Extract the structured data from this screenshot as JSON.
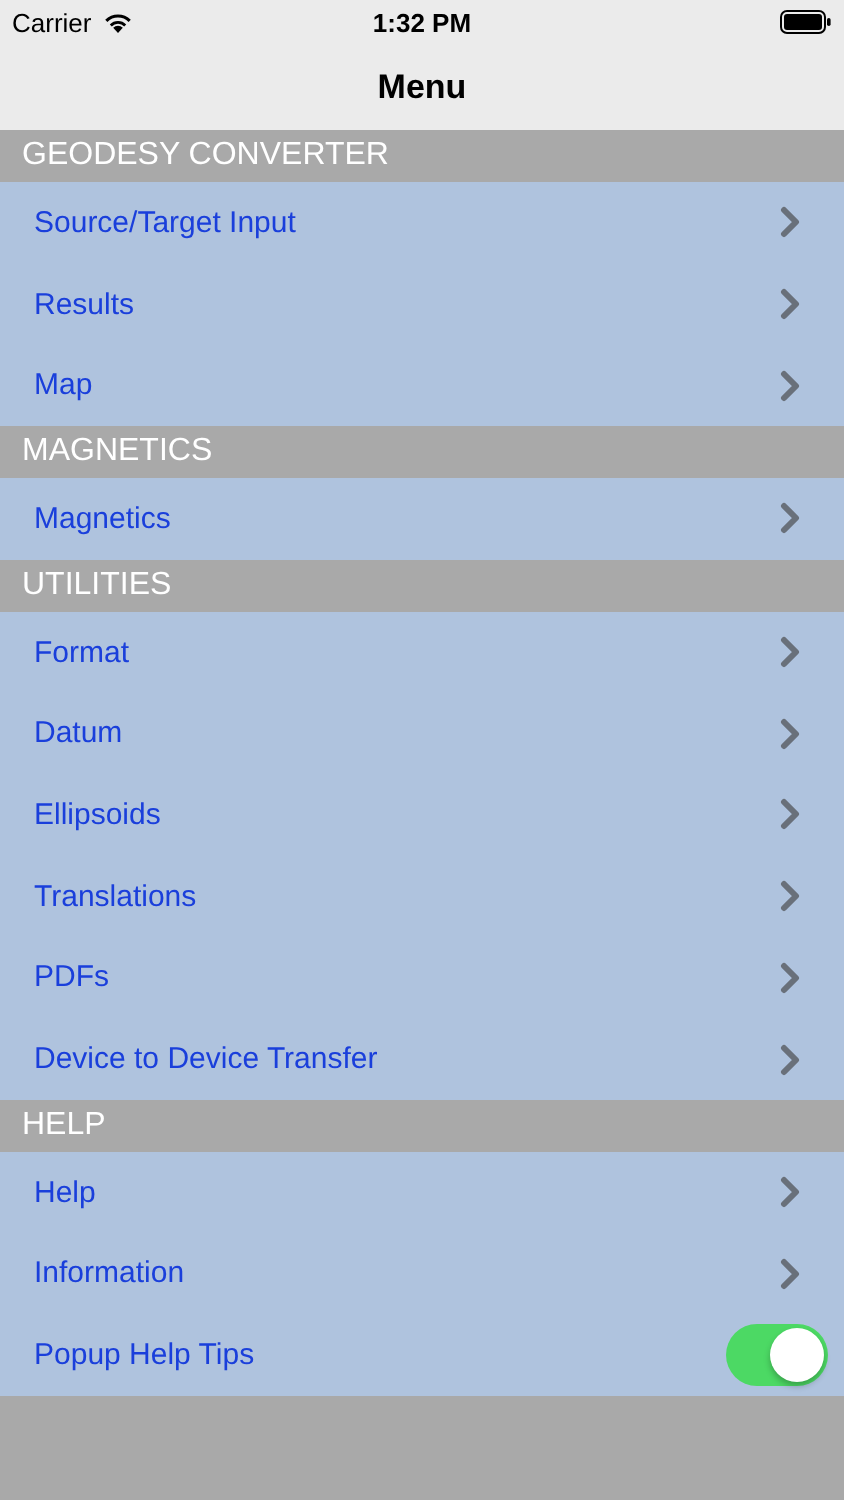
{
  "status_bar": {
    "carrier": "Carrier",
    "time": "1:32 PM"
  },
  "nav_bar": {
    "title": "Menu"
  },
  "sections": [
    {
      "title": "GEODESY CONVERTER",
      "items": [
        {
          "label": "Source/Target Input",
          "kind": "link"
        },
        {
          "label": "Results",
          "kind": "link"
        },
        {
          "label": "Map",
          "kind": "link"
        }
      ]
    },
    {
      "title": "MAGNETICS",
      "items": [
        {
          "label": "Magnetics",
          "kind": "link"
        }
      ]
    },
    {
      "title": "UTILITIES",
      "items": [
        {
          "label": "Format",
          "kind": "link"
        },
        {
          "label": "Datum",
          "kind": "link"
        },
        {
          "label": "Ellipsoids",
          "kind": "link"
        },
        {
          "label": "Translations",
          "kind": "link"
        },
        {
          "label": "PDFs",
          "kind": "link"
        },
        {
          "label": "Device to Device Transfer",
          "kind": "link"
        }
      ]
    },
    {
      "title": "HELP",
      "items": [
        {
          "label": "Help",
          "kind": "link"
        },
        {
          "label": "Information",
          "kind": "link"
        },
        {
          "label": "Popup Help Tips",
          "kind": "toggle",
          "on": true
        }
      ]
    }
  ]
}
